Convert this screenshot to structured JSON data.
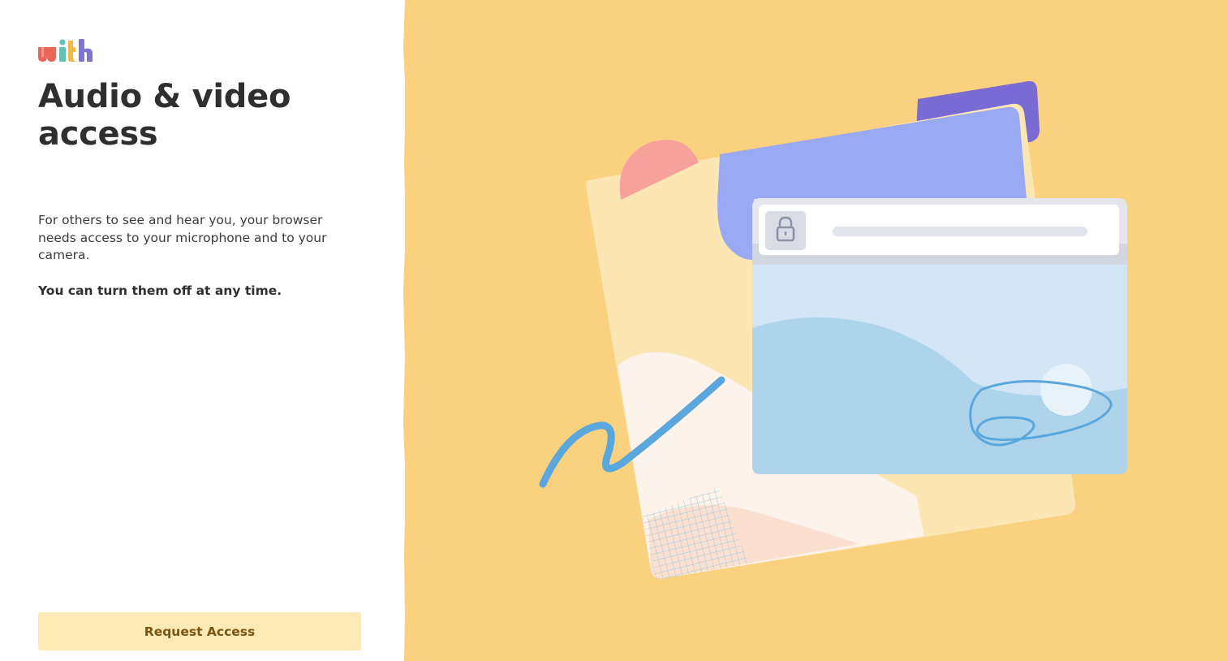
{
  "brand": {
    "logo_text": "with",
    "logo_colors": [
      "#e8675a",
      "#e8675a",
      "#5fc4b8",
      "#f5b84a",
      "#7f74d0"
    ]
  },
  "main": {
    "title": "Audio & video access",
    "description": "For others to see and hear you, your browser needs access to your microphone and to your camera.",
    "note": "You can turn them off at any time."
  },
  "actions": {
    "request_label": "Request Access"
  },
  "illustration": {
    "icon": "lock-icon"
  },
  "colors": {
    "background_accent": "#f9d17f",
    "button_bg": "#fde9b5",
    "button_text": "#7a5410",
    "title_text": "#2f2f2f"
  }
}
